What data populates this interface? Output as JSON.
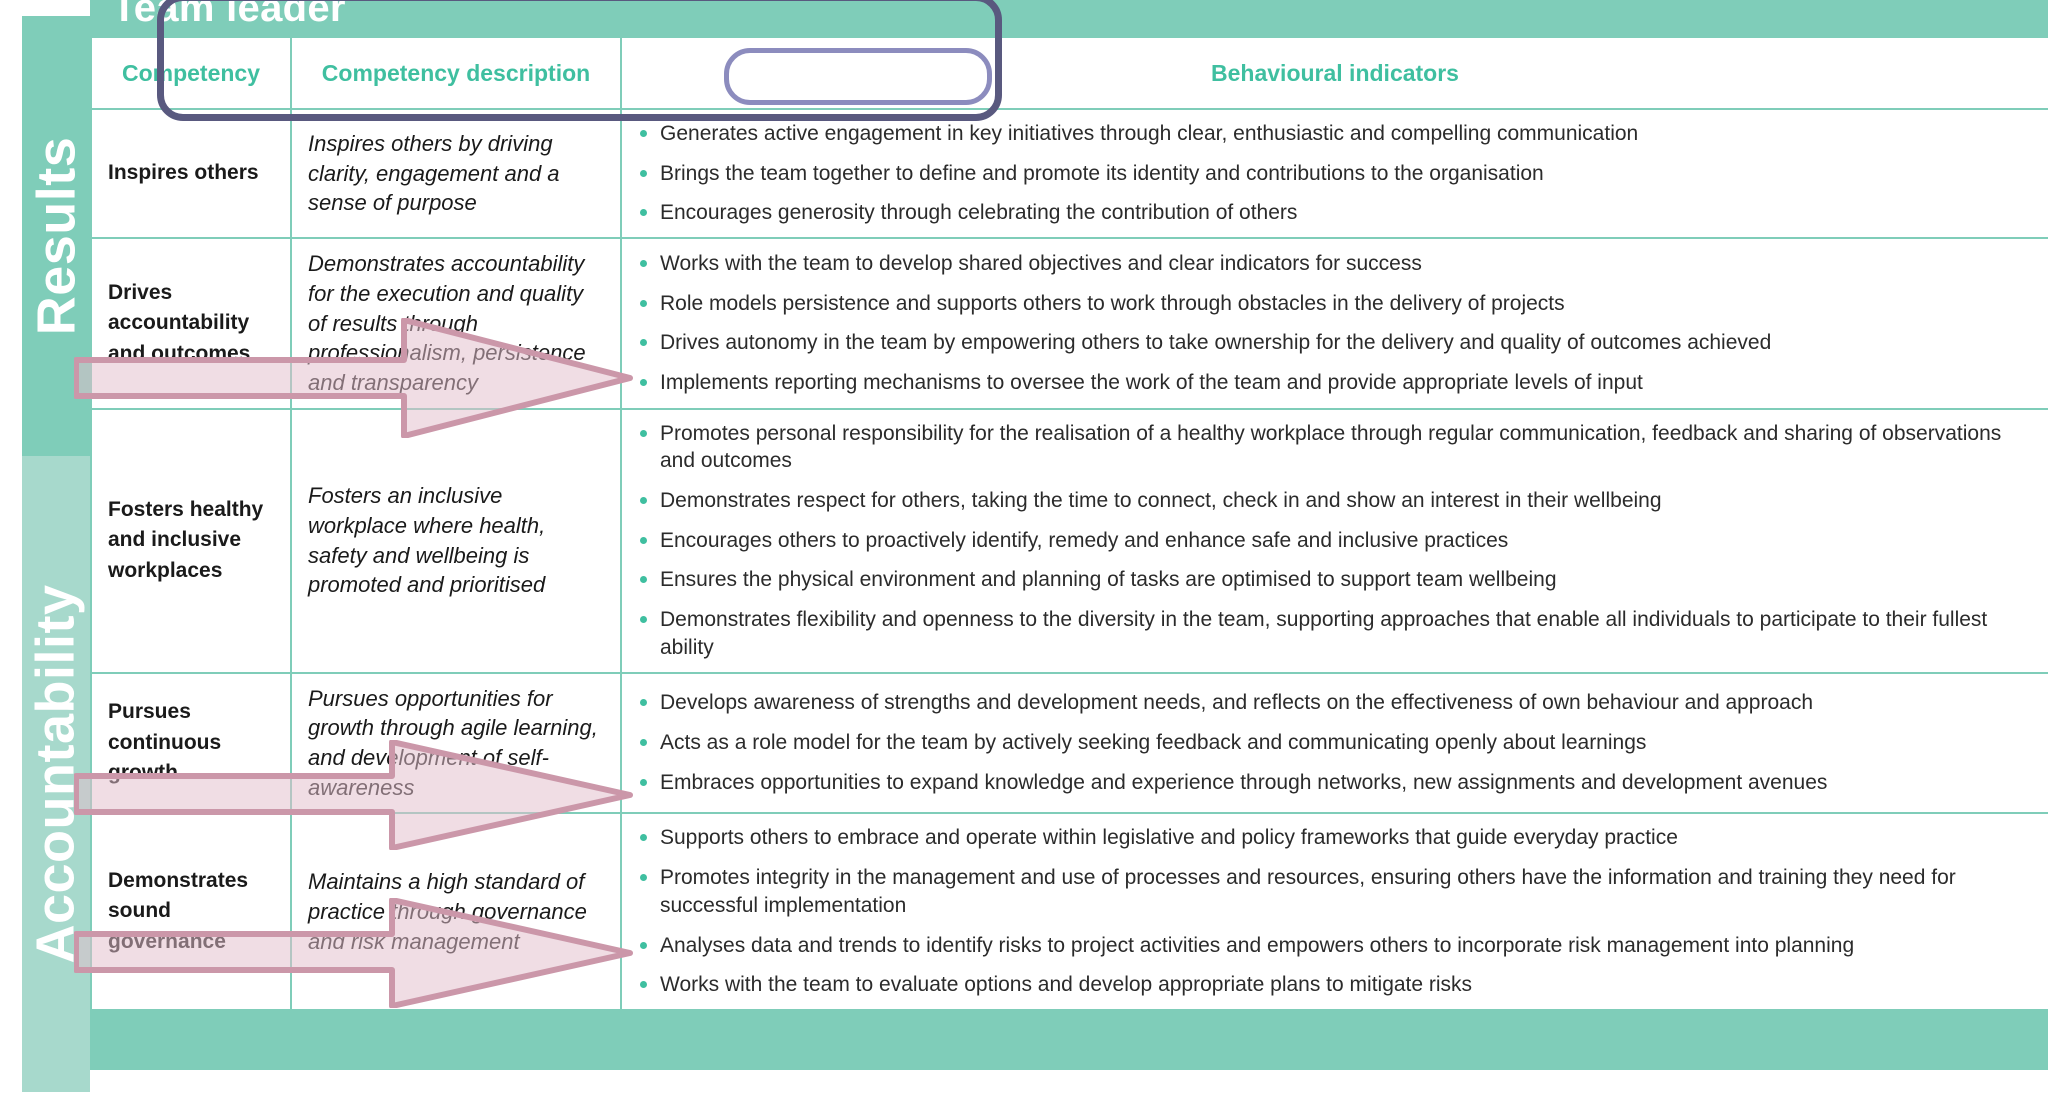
{
  "section": {
    "title": "Team leader"
  },
  "bands": [
    {
      "label": "Results",
      "color": "#7FCDB9"
    },
    {
      "label": "Accountability",
      "color": "#A7D9CC"
    }
  ],
  "table": {
    "headers": [
      {
        "label": "Competency",
        "name": "header-competency"
      },
      {
        "label": "Competency description",
        "name": "header-competency-description"
      },
      {
        "label": "Behavioural indicators",
        "name": "header-behavioural-indicators"
      }
    ],
    "rows": [
      {
        "competency": "Inspires others",
        "description": "Inspires others by driving clarity, engagement and a sense of purpose",
        "indicators": [
          "Generates active engagement in key initiatives through clear, enthusiastic and compelling communication",
          "Brings the team together to define and promote its identity and contributions to the organisation",
          "Encourages generosity through celebrating the contribution of others"
        ]
      },
      {
        "competency": "Drives accountability and outcomes",
        "description": "Demonstrates accountability for the execution and quality of results through professionalism, persistence and transparency",
        "indicators": [
          "Works with the team to develop shared objectives and clear indicators for success",
          "Role models persistence and supports others to work through obstacles in the delivery of projects",
          "Drives autonomy in the team by empowering others to take ownership for the delivery and quality of outcomes achieved",
          "Implements reporting mechanisms to oversee the work of the team and provide appropriate levels of input"
        ]
      },
      {
        "competency": "Fosters healthy and inclusive workplaces",
        "description": "Fosters an inclusive workplace where health, safety and wellbeing is promoted and prioritised",
        "indicators": [
          "Promotes personal responsibility for the realisation of a healthy workplace through regular communication, feedback and sharing of observations and outcomes",
          "Demonstrates respect for others, taking the time to connect, check in and show an interest in their wellbeing",
          "Encourages others to proactively identify, remedy and enhance safe and inclusive practices",
          "Ensures the physical environment and planning of tasks are optimised to support team wellbeing",
          "Demonstrates flexibility and openness to the diversity in the team, supporting approaches that enable all individuals to participate to their fullest ability"
        ]
      },
      {
        "competency": "Pursues continuous growth",
        "description": "Pursues opportunities for growth through agile learning, and development of self-awareness",
        "indicators": [
          "Develops awareness of strengths and development needs, and reflects on the effectiveness of own behaviour and approach",
          "Acts as a role model for the team by actively seeking feedback and communicating openly about learnings",
          "Embraces opportunities to expand knowledge and experience through networks, new assignments and development avenues"
        ]
      },
      {
        "competency": "Demonstrates sound governance",
        "description": "Maintains a high standard of practice through governance and risk management",
        "indicators": [
          "Supports others to embrace and operate within legislative and policy frameworks that guide everyday practice",
          "Promotes integrity in the management and use of processes and resources, ensuring others have the information and training they need for successful implementation",
          "Analyses data and trends to identify risks to project activities and empowers others to incorporate risk management into planning",
          "Works with the team to evaluate options and develop appropriate plans to mitigate risks"
        ]
      }
    ]
  },
  "annotations": {
    "header_highlight_color": "#59597F",
    "behavioural_highlight_color": "#8C8CBE",
    "arrow_color": "#CB97A9",
    "arrow_fill": "#E8CAD4"
  },
  "colors": {
    "teal_dark": "#7FCDB9",
    "teal_light": "#A7D9CC",
    "accent_green": "#3FBFA0",
    "text": "#1a1a1a"
  }
}
